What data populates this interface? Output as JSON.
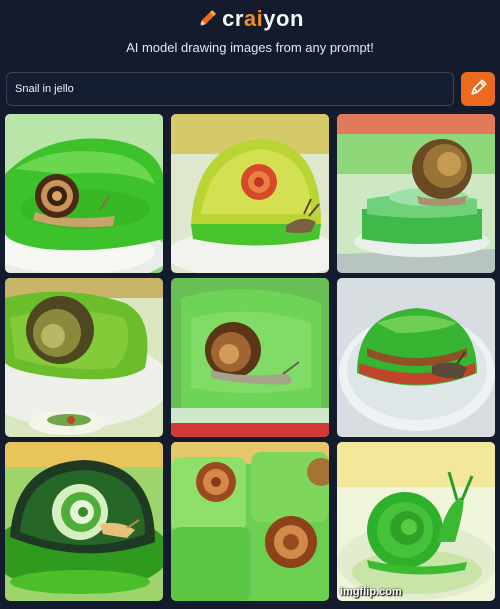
{
  "app": {
    "brand_prefix": "cr",
    "brand_accent": "ai",
    "brand_suffix": "yon",
    "tagline": "AI model drawing images from any prompt!",
    "accent_color": "#ea6b1d"
  },
  "prompt": {
    "value": "Snail in jello",
    "draw_icon": "pencil-icon"
  },
  "results": {
    "images": [
      {
        "subject": "snail-on-green-jello"
      },
      {
        "subject": "yellow-green-jello-dome-with-snail"
      },
      {
        "subject": "snail-on-stacked-jello"
      },
      {
        "subject": "snail-shell-in-jello"
      },
      {
        "subject": "snail-in-jello-cup"
      },
      {
        "subject": "layered-red-green-jello-with-snail"
      },
      {
        "subject": "spiral-snail-in-dark-jello"
      },
      {
        "subject": "snail-shells-in-jello-cubes"
      },
      {
        "subject": "green-jello-snail"
      }
    ]
  },
  "watermark": "imgflip.com"
}
